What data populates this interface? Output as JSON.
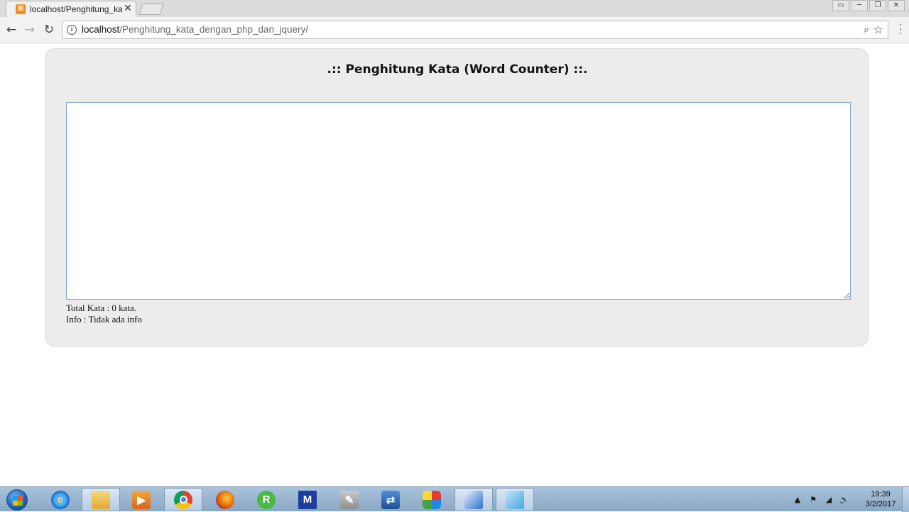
{
  "browser": {
    "tab": {
      "title": "localhost/Penghitung_ka",
      "close": "✕"
    },
    "nav": {
      "back": "←",
      "forward": "→",
      "reload": "↻"
    },
    "address": {
      "host": "localhost",
      "path": "/Penghitung_kata_dengan_php_dan_jquery/",
      "info": "i"
    },
    "window_buttons": [
      "▭",
      "─",
      "❐",
      "✕"
    ]
  },
  "page": {
    "title": ".:: Penghitung Kata (Word Counter) ::.",
    "textarea_value": "",
    "total_label": "Total Kata : 0 kata.",
    "info_label": "Info : Tidak ada info"
  },
  "taskbar": {
    "apps": [
      {
        "name": "internet-explorer-icon",
        "glyph": "e"
      },
      {
        "name": "windows-explorer-icon",
        "glyph": ""
      },
      {
        "name": "media-player-icon",
        "glyph": "▶"
      },
      {
        "name": "chrome-icon",
        "glyph": ""
      },
      {
        "name": "firefox-icon",
        "glyph": ""
      },
      {
        "name": "r-app-icon",
        "glyph": "R"
      },
      {
        "name": "m-app-icon",
        "glyph": "M"
      },
      {
        "name": "tool-app-icon",
        "glyph": "✎"
      },
      {
        "name": "network-app-icon",
        "glyph": "⇄"
      },
      {
        "name": "apps-icon",
        "glyph": ""
      },
      {
        "name": "cube-app-icon",
        "glyph": "◆"
      },
      {
        "name": "notes-app-icon",
        "glyph": ""
      }
    ],
    "tray": {
      "arrow": "▲",
      "flag": "⚑",
      "network": "◢",
      "volume": "🔊"
    },
    "clock": {
      "time": "19:39",
      "date": "3/2/2017"
    }
  }
}
